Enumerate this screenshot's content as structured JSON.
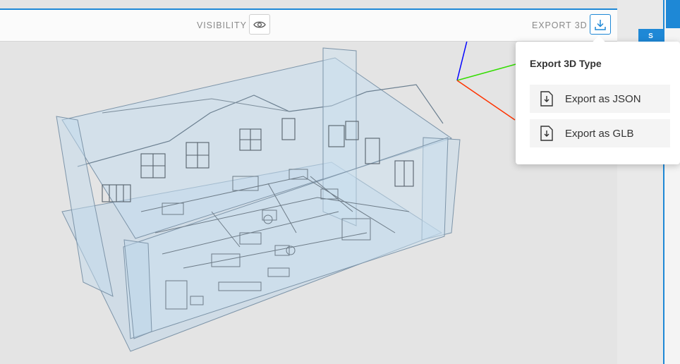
{
  "toolbar": {
    "visibility_label": "VISIBILITY",
    "export_label": "EXPORT 3D"
  },
  "export_menu": {
    "title": "Export 3D Type",
    "items": [
      {
        "label": "Export as JSON",
        "icon": "file-download-icon"
      },
      {
        "label": "Export as GLB",
        "icon": "file-download-icon"
      }
    ]
  },
  "right_panel": {
    "tab_letter": "S"
  },
  "colors": {
    "accent": "#1e88d6",
    "axis_x": "#ff3300",
    "axis_y": "#33dd00",
    "axis_z": "#0000ff",
    "model_tint": "#bfd9ec"
  },
  "icons": {
    "visibility": "eye-icon",
    "export": "download-icon"
  }
}
